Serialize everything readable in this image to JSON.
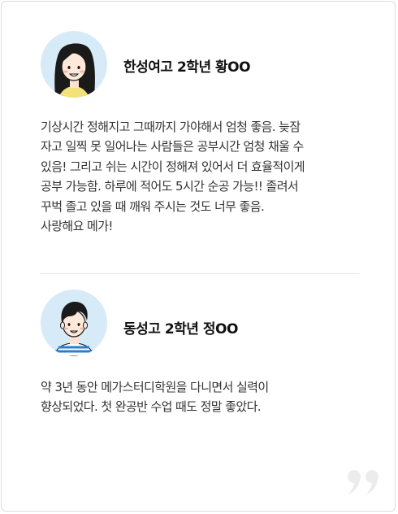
{
  "reviews": [
    {
      "name": "한성여고 2학년 황OO",
      "avatar": "female-student-avatar",
      "text": "기상시간 정해지고 그때까지 가야해서 엄청 좋음. 늦잠\n자고 일찍 못 일어나는 사람들은 공부시간 엄청 채울 수\n있음! 그리고 쉬는 시간이 정해져 있어서 더 효율적이게\n공부 가능함. 하루에 적어도 5시간 순공 가능!! 졸려서\n꾸벅 졸고 있을 때 깨워 주시는 것도 너무 좋음.\n사랑해요 메가!"
    },
    {
      "name": "동성고 2학년 정OO",
      "avatar": "male-student-avatar",
      "text": "약 3년 동안 메가스터디학원을 다니면서 실력이\n향상되었다. 첫 완공반 수업 때도 정말 좋았다."
    }
  ],
  "icons": {
    "quote": "closing-quote-icon"
  },
  "colors": {
    "avatar_bg": "#d6ebf7",
    "stripe": "#2a7fcf",
    "quote": "#ececec"
  }
}
